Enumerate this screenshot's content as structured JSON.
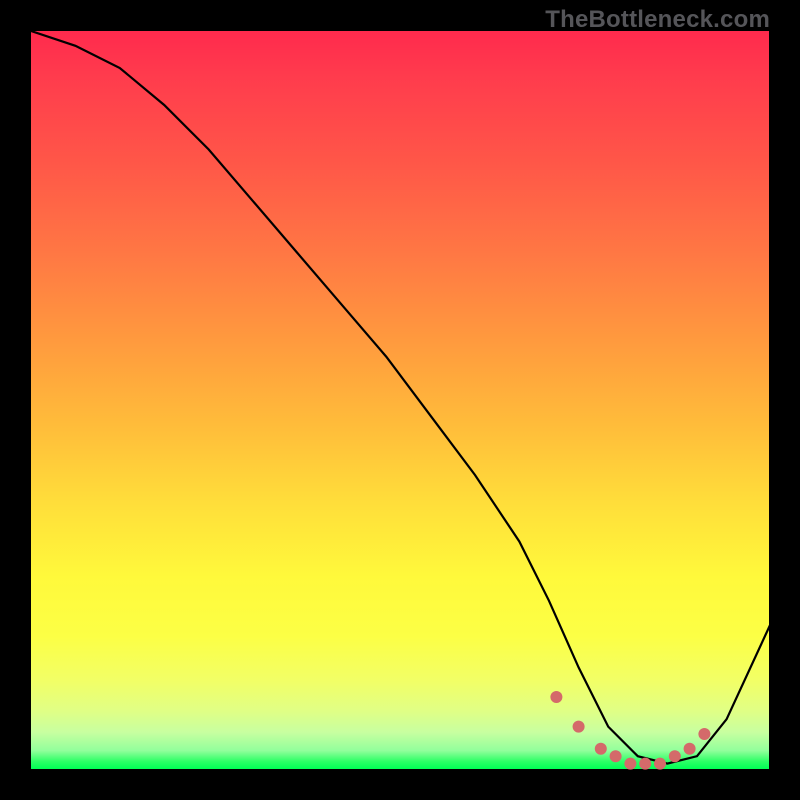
{
  "watermark": "TheBottleneck.com",
  "chart_data": {
    "type": "line",
    "title": "",
    "xlabel": "",
    "ylabel": "",
    "xlim": [
      0,
      100
    ],
    "ylim": [
      0,
      100
    ],
    "series": [
      {
        "name": "curve",
        "x": [
          0,
          6,
          12,
          18,
          24,
          30,
          36,
          42,
          48,
          54,
          60,
          66,
          70,
          74,
          78,
          82,
          86,
          90,
          94,
          100
        ],
        "values": [
          100,
          98,
          95,
          90,
          84,
          77,
          70,
          63,
          56,
          48,
          40,
          31,
          23,
          14,
          6,
          2,
          1,
          2,
          7,
          20
        ]
      }
    ],
    "dots": {
      "name": "highlight-dots",
      "x": [
        71,
        74,
        77,
        79,
        81,
        83,
        85,
        87,
        89,
        91
      ],
      "values": [
        10,
        6,
        3,
        2,
        1,
        1,
        1,
        2,
        3,
        5
      ]
    },
    "background_gradient": {
      "top": "#ff2a4d",
      "middle": "#fff93b",
      "bottom": "#00ff55"
    }
  }
}
